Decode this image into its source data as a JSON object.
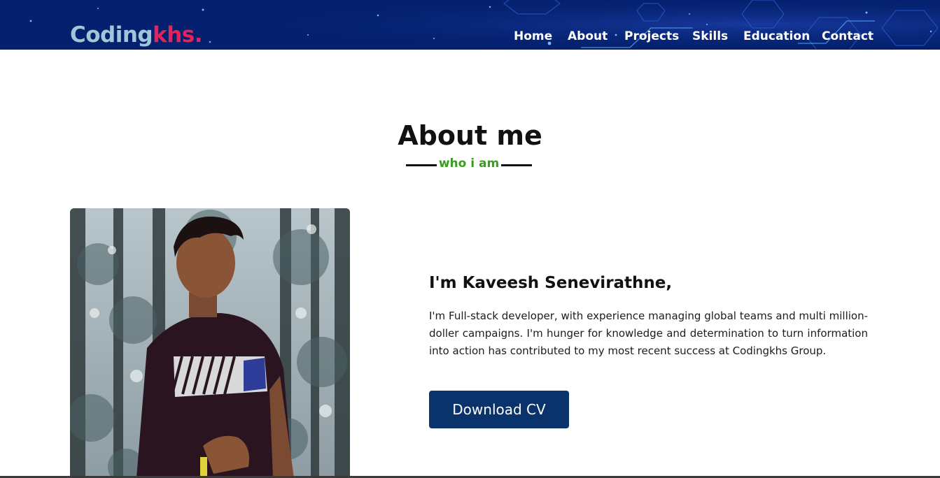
{
  "navbar": {
    "logo_main": "Coding",
    "logo_accent": "khs.",
    "links": [
      "Home",
      "About",
      "Projects",
      "Skills",
      "Education",
      "Contact"
    ]
  },
  "about": {
    "title": "About me",
    "subtitle": "who i am",
    "name": "I'm Kaveesh Senevirathne,",
    "description": "I'm Full-stack developer, with experience managing global teams and multi million-doller campaigns. I'm hunger for knowledge and determination to turn information into action has contributed to my most recent success at Codingkhs Group.",
    "download_label": "Download CV"
  },
  "colors": {
    "navbar_bg": "#04206e",
    "logo_main": "#9fc7d8",
    "logo_accent": "#e3245a",
    "subtitle": "#3a9d22",
    "button": "#0a336b"
  }
}
